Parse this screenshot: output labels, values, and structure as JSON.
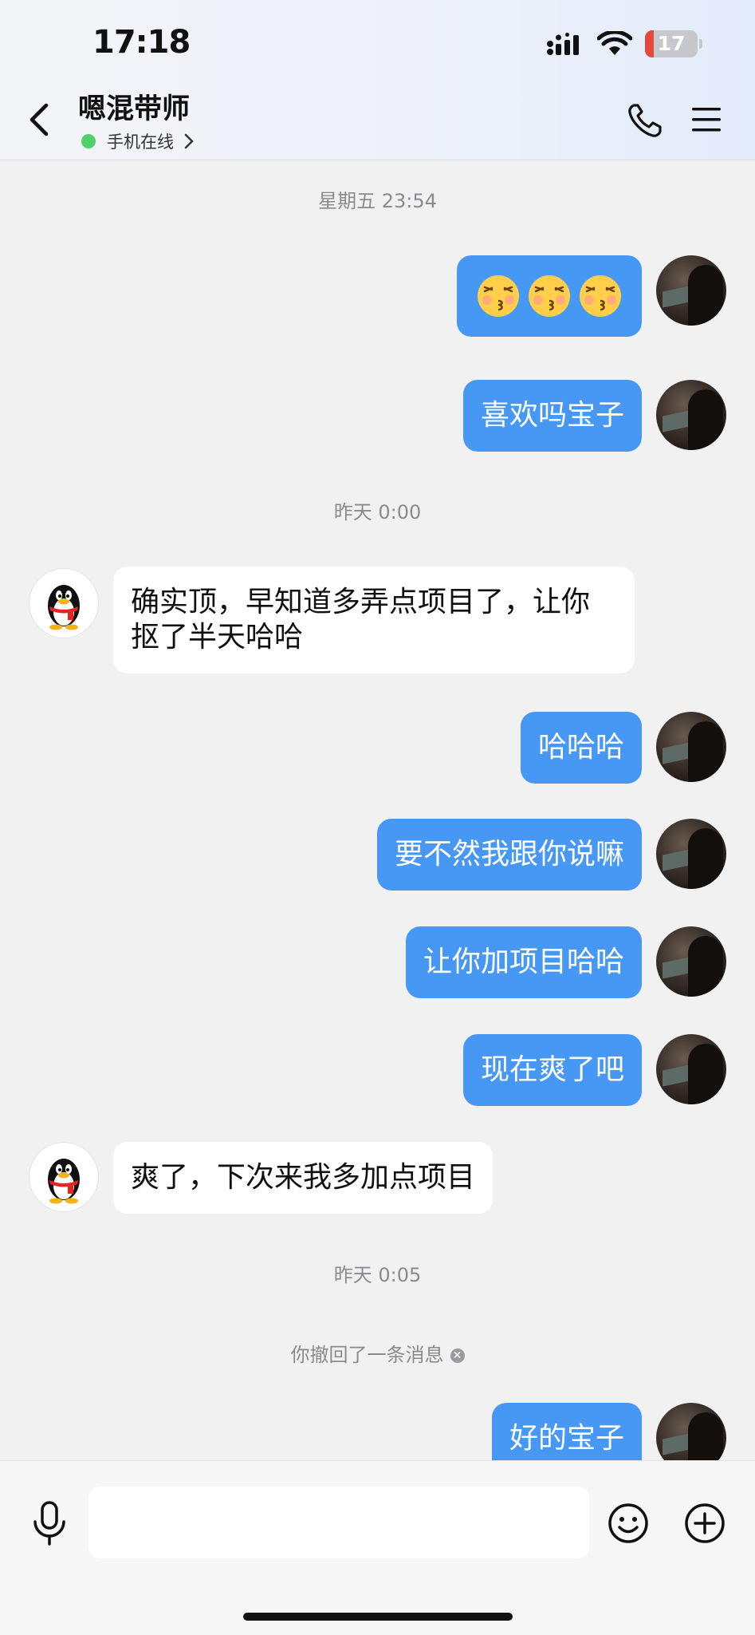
{
  "status_bar": {
    "time": "17:18",
    "battery": "17",
    "battery_level": 0.17
  },
  "header": {
    "title": "嗯混带师",
    "presence": "手机在线",
    "icons": [
      "back-icon",
      "phone-icon",
      "menu-icon"
    ]
  },
  "messages": {
    "ts1": "星期五 23:54",
    "m1": "😚😚😚",
    "m2": "喜欢吗宝子",
    "ts2": "昨天 0:00",
    "m3_line1": "确实顶，早知道多弄点项目了，让你",
    "m3_line2": "抠了半天哈哈",
    "m4": "哈哈哈",
    "m5": "要不然我跟你说嘛",
    "m6": "让你加项目哈哈",
    "m7": "现在爽了吧",
    "m8": "爽了，下次来我多加点项目",
    "ts3": "昨天 0:05",
    "notice": "你撤回了一条消息",
    "m9": "好的宝子"
  },
  "input": {
    "placeholder": "",
    "icons": [
      "microphone-icon",
      "emoji-icon",
      "plus-icon"
    ]
  },
  "colors": {
    "outgoing_bubble": "#4798f5",
    "incoming_bubble": "#ffffff",
    "background": "#f1f1f2",
    "online_dot": "#52d06c"
  }
}
